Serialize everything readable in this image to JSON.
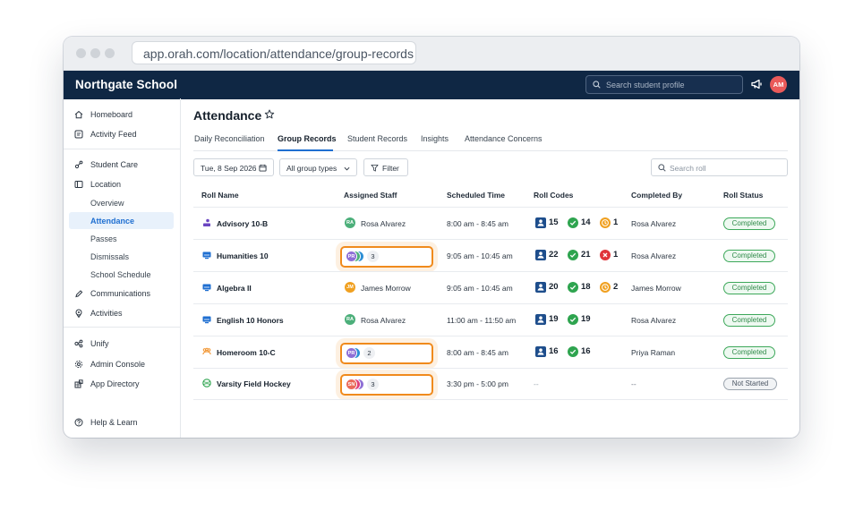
{
  "browser": {
    "url": "app.orah.com/location/attendance/group-records"
  },
  "topbar": {
    "brand": "Northgate School",
    "search_placeholder": "Search student profile",
    "user_initials": "AM"
  },
  "sidebar": {
    "items": [
      {
        "label": "Homeboard",
        "icon": "home-icon"
      },
      {
        "label": "Activity Feed",
        "icon": "feed-icon"
      },
      {
        "label": "Student Care",
        "icon": "student-care-icon"
      },
      {
        "label": "Location",
        "icon": "location-icon"
      },
      {
        "label": "Communications",
        "icon": "communications-icon"
      },
      {
        "label": "Activities",
        "icon": "activities-icon"
      },
      {
        "label": "Unify",
        "icon": "unify-icon"
      },
      {
        "label": "Admin Console",
        "icon": "gear-icon"
      },
      {
        "label": "App Directory",
        "icon": "app-directory-icon"
      },
      {
        "label": "Help & Learn",
        "icon": "help-icon"
      }
    ],
    "location_sub": [
      "Overview",
      "Attendance",
      "Passes",
      "Dismissals",
      "School Schedule"
    ],
    "active": "Attendance"
  },
  "page": {
    "title": "Attendance",
    "tabs": [
      "Daily Reconciliation",
      "Group Records",
      "Student Records",
      "Insights",
      "Attendance Concerns"
    ],
    "active_tab": "Group Records",
    "date": "Tue, 8 Sep 2026",
    "group_filter": "All group types",
    "filter_label": "Filter",
    "search_placeholder": "Search roll"
  },
  "table": {
    "headers": [
      "Roll Name",
      "Assigned Staff",
      "Scheduled Time",
      "Roll Codes",
      "Completed By",
      "Roll Status"
    ],
    "rows": [
      {
        "name": "Advisory 10-B",
        "icon": "advisory-icon",
        "staff_initials": "RA",
        "staff": "Rosa Alvarez",
        "time": "8:00 am - 8:45 am",
        "codes": {
          "present": "15",
          "ok": "14",
          "late": "1"
        },
        "completed_by": "Rosa Alvarez",
        "status": "Completed"
      },
      {
        "name": "Humanities 10",
        "icon": "class-icon",
        "staff_stack": [
          "PR",
          "",
          ""
        ],
        "staff_count": "3",
        "time": "9:05 am - 10:45 am",
        "codes": {
          "present": "22",
          "ok": "21",
          "absent": "1"
        },
        "completed_by": "Rosa Alvarez",
        "status": "Completed"
      },
      {
        "name": "Algebra II",
        "icon": "class-icon",
        "staff_initials": "JM",
        "staff": "James Morrow",
        "time": "9:05 am - 10:45 am",
        "codes": {
          "present": "20",
          "ok": "18",
          "late": "2"
        },
        "completed_by": "James Morrow",
        "status": "Completed"
      },
      {
        "name": "English 10 Honors",
        "icon": "class-icon",
        "staff_initials": "RA",
        "staff": "Rosa Alvarez",
        "time": "11:00 am - 11:50 am",
        "codes": {
          "present": "19",
          "ok": "19"
        },
        "completed_by": "Rosa Alvarez",
        "status": "Completed"
      },
      {
        "name": "Homeroom 10-C",
        "icon": "homeroom-icon",
        "staff_stack": [
          "PR",
          ""
        ],
        "staff_count": "2",
        "time": "8:00 am - 8:45 am",
        "codes": {
          "present": "16",
          "ok": "16"
        },
        "completed_by": "Priya Raman",
        "status": "Completed"
      },
      {
        "name": "Varsity Field Hockey",
        "icon": "sport-icon",
        "staff_stack": [
          "SN",
          "",
          ""
        ],
        "staff_count": "3",
        "time": "3:30 pm - 5:00 pm",
        "codes_text": "--",
        "completed_by": "--",
        "status": "Not Started"
      }
    ]
  },
  "colors": {
    "navbar": "#0f2744",
    "accent": "#1f6fd1",
    "highlight": "#f08a1c",
    "completed": "#3da85a"
  }
}
